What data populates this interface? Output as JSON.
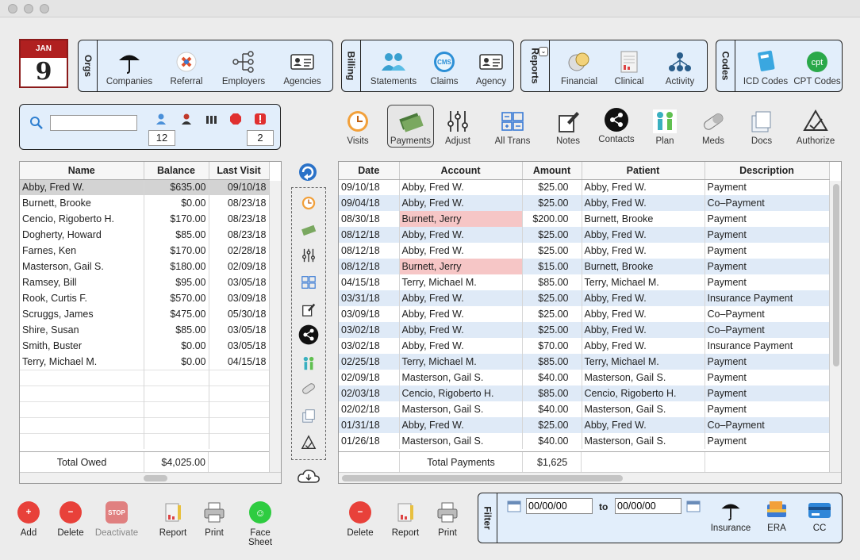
{
  "calendar": {
    "month": "JAN",
    "day": "9"
  },
  "groups": {
    "orgs": {
      "label": "Orgs",
      "items": [
        "Companies",
        "Referral",
        "Employers",
        "Agencies"
      ]
    },
    "billing": {
      "label": "Billing",
      "items": [
        "Statements",
        "Claims",
        "Agency"
      ]
    },
    "reports": {
      "label": "Reports",
      "items": [
        "Financial",
        "Clinical",
        "Activity"
      ]
    },
    "codes": {
      "label": "Codes",
      "items": [
        "ICD Codes",
        "CPT Codes"
      ]
    }
  },
  "search": {
    "placeholder": "",
    "count_left": "12",
    "count_right": "2"
  },
  "toolbar": [
    "Visits",
    "Payments",
    "Adjust",
    "All Trans",
    "Notes",
    "Contacts",
    "Plan",
    "Meds",
    "Docs",
    "Authorize"
  ],
  "patients": {
    "headers": [
      "Name",
      "Balance",
      "Last Visit"
    ],
    "rows": [
      [
        "Abby, Fred W.",
        "$635.00",
        "09/10/18"
      ],
      [
        "Burnett, Brooke",
        "$0.00",
        "08/23/18"
      ],
      [
        "Cencio, Rigoberto H.",
        "$170.00",
        "08/23/18"
      ],
      [
        "Dogherty, Howard",
        "$85.00",
        "08/23/18"
      ],
      [
        "Farnes, Ken",
        "$170.00",
        "02/28/18"
      ],
      [
        "Masterson, Gail S.",
        "$180.00",
        "02/09/18"
      ],
      [
        "Ramsey, Bill",
        "$95.00",
        "03/05/18"
      ],
      [
        "Rook, Curtis F.",
        "$570.00",
        "03/09/18"
      ],
      [
        "Scruggs, James",
        "$475.00",
        "05/30/18"
      ],
      [
        "Shire, Susan",
        "$85.00",
        "03/05/18"
      ],
      [
        "Smith, Buster",
        "$0.00",
        "03/05/18"
      ],
      [
        "Terry, Michael M.",
        "$0.00",
        "04/15/18"
      ]
    ],
    "total_label": "Total Owed",
    "total_value": "$4,025.00"
  },
  "payments": {
    "headers": [
      "Date",
      "Account",
      "Amount",
      "Patient",
      "Description"
    ],
    "rows": [
      [
        "09/10/18",
        "Abby, Fred W.",
        "$25.00",
        "Abby, Fred W.",
        "Payment"
      ],
      [
        "09/04/18",
        "Abby, Fred W.",
        "$25.00",
        "Abby, Fred W.",
        "Co–Payment"
      ],
      [
        "08/30/18",
        "Burnett, Jerry",
        "$200.00",
        "Burnett, Brooke",
        "Payment"
      ],
      [
        "08/12/18",
        "Abby, Fred W.",
        "$25.00",
        "Abby, Fred W.",
        "Payment"
      ],
      [
        "08/12/18",
        "Abby, Fred W.",
        "$25.00",
        "Abby, Fred W.",
        "Payment"
      ],
      [
        "08/12/18",
        "Burnett, Jerry",
        "$15.00",
        "Burnett, Brooke",
        "Payment"
      ],
      [
        "04/15/18",
        "Terry, Michael M.",
        "$85.00",
        "Terry, Michael M.",
        "Payment"
      ],
      [
        "03/31/18",
        "Abby, Fred W.",
        "$25.00",
        "Abby, Fred W.",
        "Insurance Payment"
      ],
      [
        "03/09/18",
        "Abby, Fred W.",
        "$25.00",
        "Abby, Fred W.",
        "Co–Payment"
      ],
      [
        "03/02/18",
        "Abby, Fred W.",
        "$25.00",
        "Abby, Fred W.",
        "Co–Payment"
      ],
      [
        "03/02/18",
        "Abby, Fred W.",
        "$70.00",
        "Abby, Fred W.",
        "Insurance Payment"
      ],
      [
        "02/25/18",
        "Terry, Michael M.",
        "$85.00",
        "Terry, Michael M.",
        "Payment"
      ],
      [
        "02/09/18",
        "Masterson, Gail S.",
        "$40.00",
        "Masterson, Gail S.",
        "Payment"
      ],
      [
        "02/03/18",
        "Cencio, Rigoberto H.",
        "$85.00",
        "Cencio, Rigoberto H.",
        "Payment"
      ],
      [
        "02/02/18",
        "Masterson, Gail S.",
        "$40.00",
        "Masterson, Gail S.",
        "Payment"
      ],
      [
        "01/31/18",
        "Abby, Fred W.",
        "$25.00",
        "Abby, Fred W.",
        "Co–Payment"
      ],
      [
        "01/26/18",
        "Masterson, Gail S.",
        "$40.00",
        "Masterson, Gail S.",
        "Payment"
      ]
    ],
    "highlight_rows": [
      2,
      5
    ],
    "total_label": "Total Payments",
    "total_value": "$1,625"
  },
  "bottom_left": [
    "Add",
    "Delete",
    "Deactivate",
    "Report",
    "Print",
    "Face Sheet"
  ],
  "bottom_mid": [
    "Delete",
    "Report",
    "Print"
  ],
  "filter": {
    "label": "Filter",
    "from": "00/00/00",
    "to_label": "to",
    "to": "00/00/00",
    "buttons": [
      "Insurance",
      "ERA",
      "CC"
    ]
  },
  "colors": {
    "accent_group": "#e2eefb",
    "row_alt": "#dfeaf7",
    "highlight": "#f6c6c6",
    "selected": "#d3d3d3"
  }
}
